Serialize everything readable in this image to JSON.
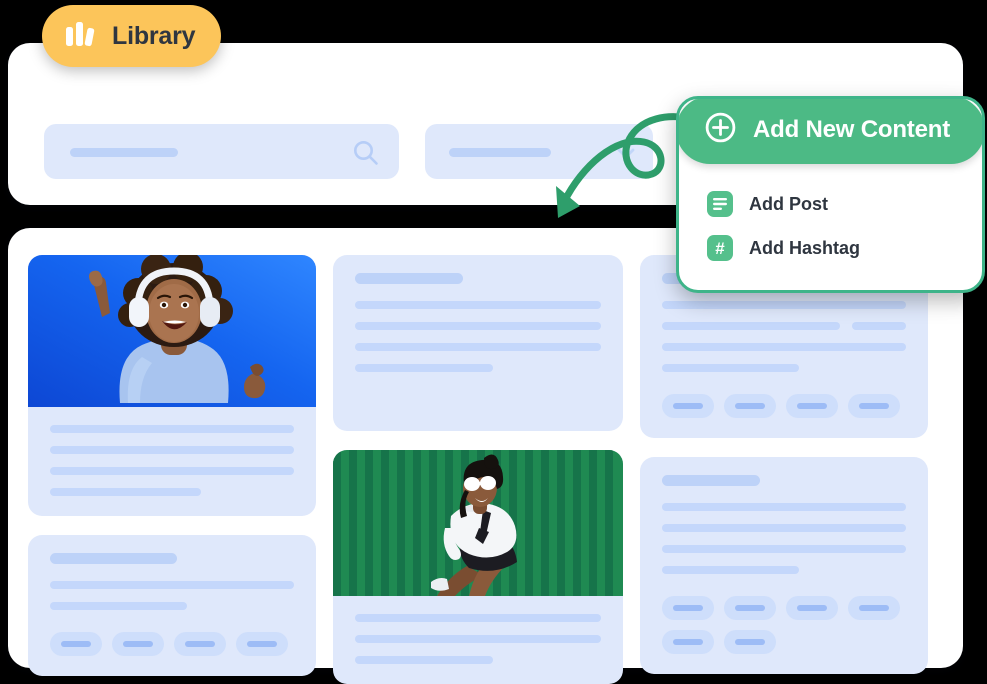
{
  "badge": {
    "label": "Library",
    "icon": "books-icon",
    "color": "#fcc55a"
  },
  "toolbar": {
    "search": {
      "name": "search-input",
      "value": "",
      "placeholder": "",
      "icon": "search-icon"
    },
    "filter": {
      "name": "filter-select",
      "value": "",
      "icon": "chevron-down-icon"
    }
  },
  "annotation": {
    "arrow": "curly-arrow-icon",
    "color": "#2e9e6b"
  },
  "add_menu": {
    "accent": "#4cba85",
    "border": "#3eb489",
    "header": {
      "label": "Add New Content",
      "icon": "plus-circle-icon"
    },
    "items": [
      {
        "label": "Add Post",
        "icon": "post-lines-icon"
      },
      {
        "label": "Add Hashtag",
        "icon": "hashtag-icon"
      }
    ]
  },
  "library": {
    "placeholder_color": "#dfe8fb",
    "columns": [
      {
        "name": "column-left",
        "cards": [
          {
            "name": "photo-card-headphones",
            "type": "photo",
            "photo": "woman-with-headphones-blue-background",
            "lines": [
              100,
              100,
              100,
              62
            ],
            "tags": 0,
            "title": false
          },
          {
            "name": "placeholder-card",
            "type": "text",
            "lines": [
              100,
              56
            ],
            "tags": 4,
            "title": true
          }
        ]
      },
      {
        "name": "column-middle",
        "cards": [
          {
            "name": "placeholder-card",
            "type": "text",
            "lines": [
              100,
              100,
              100,
              56
            ],
            "tags": 0,
            "title": true
          },
          {
            "name": "photo-card-green-wall",
            "type": "photo",
            "photo": "woman-sunglasses-green-wall",
            "lines": [
              100,
              100,
              56
            ],
            "tags": 0,
            "title": false
          }
        ]
      },
      {
        "name": "column-right",
        "cards": [
          {
            "name": "placeholder-card",
            "type": "text",
            "lines": [
              100,
              "split",
              100,
              56
            ],
            "tags": 4,
            "title": true
          },
          {
            "name": "placeholder-card",
            "type": "text",
            "lines": [
              100,
              100,
              100,
              56
            ],
            "tags": 6,
            "title": true
          }
        ]
      }
    ]
  }
}
